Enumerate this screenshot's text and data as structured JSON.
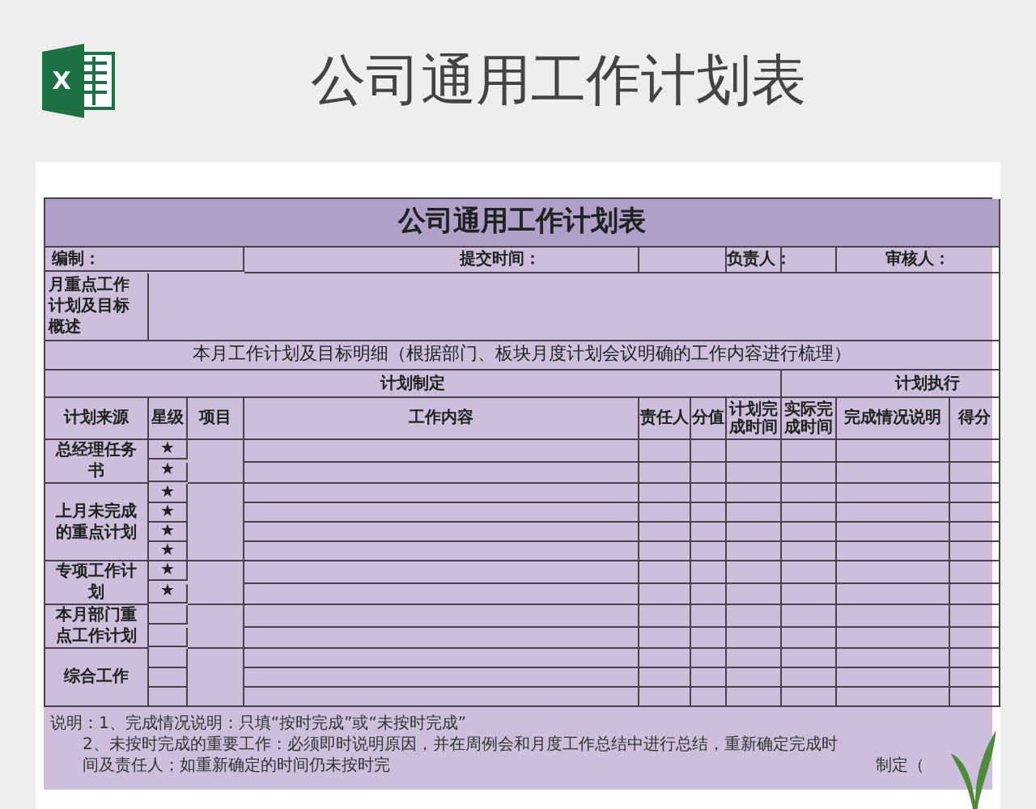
{
  "banner": {
    "logo_letter": "X",
    "title": "公司通用工作计划表"
  },
  "sheet": {
    "title": "公司通用工作计划表",
    "info": {
      "editor": "编制：",
      "submit_time": "提交时间：",
      "owner": "负责人：",
      "reviewer": "审核人："
    },
    "overview_label": "月重点工作计划及目标概述",
    "detail_heading": "本月工作计划及目标明细（根据部门、板块月度计划会议明确的工作内容进行梳理）",
    "sections": [
      "计划制定",
      "计划执行"
    ],
    "columns": [
      "计划来源",
      "星级",
      "项目",
      "工作内容",
      "责任人",
      "分值",
      "计划完成时间",
      "实际完成时间",
      "完成情况说明",
      "得分"
    ],
    "groups": [
      {
        "source": "总经理任务书",
        "rows": [
          {
            "kind": "starred",
            "star": "★"
          },
          {
            "kind": "starred",
            "star": "★"
          }
        ]
      },
      {
        "source": "上月未完成的重点计划",
        "rows": [
          {
            "kind": "starred",
            "star": "★"
          },
          {
            "kind": "starred",
            "star": "★"
          },
          {
            "kind": "starred",
            "star": "★"
          },
          {
            "kind": "starred",
            "star": "★"
          }
        ]
      },
      {
        "source": "专项工作计划",
        "rows": [
          {
            "kind": "starred",
            "star": "★"
          },
          {
            "kind": "starred",
            "star": "★"
          }
        ]
      },
      {
        "source": "本月部门重点工作计划",
        "rows": [
          {
            "kind": "blank"
          },
          {
            "kind": "blank"
          }
        ]
      },
      {
        "source": "综合工作",
        "rows": [
          {
            "kind": "blank"
          },
          {
            "kind": "blank"
          },
          {
            "kind": "blank"
          }
        ]
      }
    ],
    "notes": [
      {
        "text": "说明：1、完成情况说明：只填“按时完成”或“未按时完成”"
      },
      {
        "text": "2、未按时完成的重要工作：必须即时说明原因，并在周例会和月度工作总结中进行总结，重新确定完成时间及责任人；如重新确定的时间仍未按时完",
        "tail": "制定（"
      }
    ]
  }
}
